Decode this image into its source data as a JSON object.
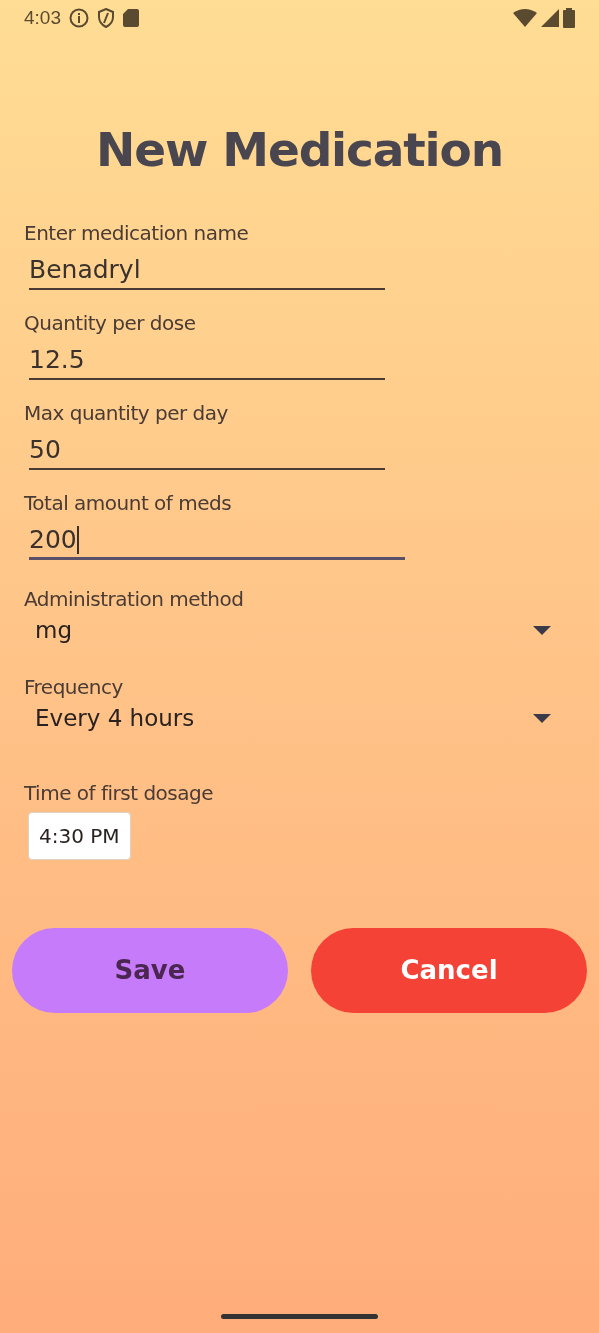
{
  "status_bar": {
    "time": "4:03"
  },
  "title": "New Medication",
  "fields": [
    {
      "kind": "text",
      "label": "Enter medication name",
      "value": "Benadryl",
      "focused": false
    },
    {
      "kind": "text",
      "label": "Quantity per dose",
      "value": "12.5",
      "focused": false
    },
    {
      "kind": "text",
      "label": "Max quantity per day",
      "value": "50",
      "focused": false
    },
    {
      "kind": "text",
      "label": "Total amount of meds",
      "value": "200",
      "focused": true
    },
    {
      "kind": "select",
      "label": "Administration method",
      "value": "mg"
    },
    {
      "kind": "select",
      "label": "Frequency",
      "value": "Every 4 hours"
    },
    {
      "kind": "time",
      "label": "Time of first dosage",
      "value": "4:30 PM"
    }
  ],
  "buttons": [
    {
      "kind": "primary",
      "label": "Save"
    },
    {
      "kind": "danger",
      "label": "Cancel"
    }
  ]
}
